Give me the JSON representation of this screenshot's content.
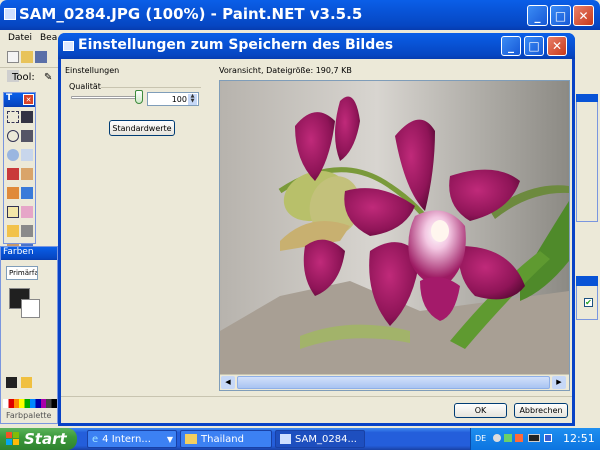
{
  "main_window": {
    "title": "SAM_0284.JPG (100%) - Paint.NET v3.5.5",
    "menu_first": "Datei",
    "menu_second": "Bea",
    "tool_label": "Tool:"
  },
  "tools_panel": {
    "title": "T"
  },
  "colors_panel": {
    "title": "Farben",
    "dropdown": "Primärfarben",
    "bottom_label": "Farbpalette"
  },
  "dialog": {
    "title": "Einstellungen zum Speichern des Bildes",
    "settings_group": "Einstellungen",
    "quality_label": "Qualität",
    "quality_value": "100",
    "quality_level": 1.0,
    "reset_button": "Standardwerte",
    "preview_label": "Voransicht, Dateigröße: 190,7 KB",
    "ok_button": "OK",
    "cancel_button": "Abbrechen"
  },
  "taskbar": {
    "start": "Start",
    "tasks": [
      "4 Intern...",
      "Thailand",
      "SAM_0284..."
    ],
    "language": "DE",
    "clock": "12:51"
  },
  "colors": {
    "xp_blue": "#0853d6",
    "taskbar_blue": "#245edb",
    "start_green": "#3c9a3c",
    "close_red": "#d8442a",
    "flower_magenta": "#8e1457"
  }
}
